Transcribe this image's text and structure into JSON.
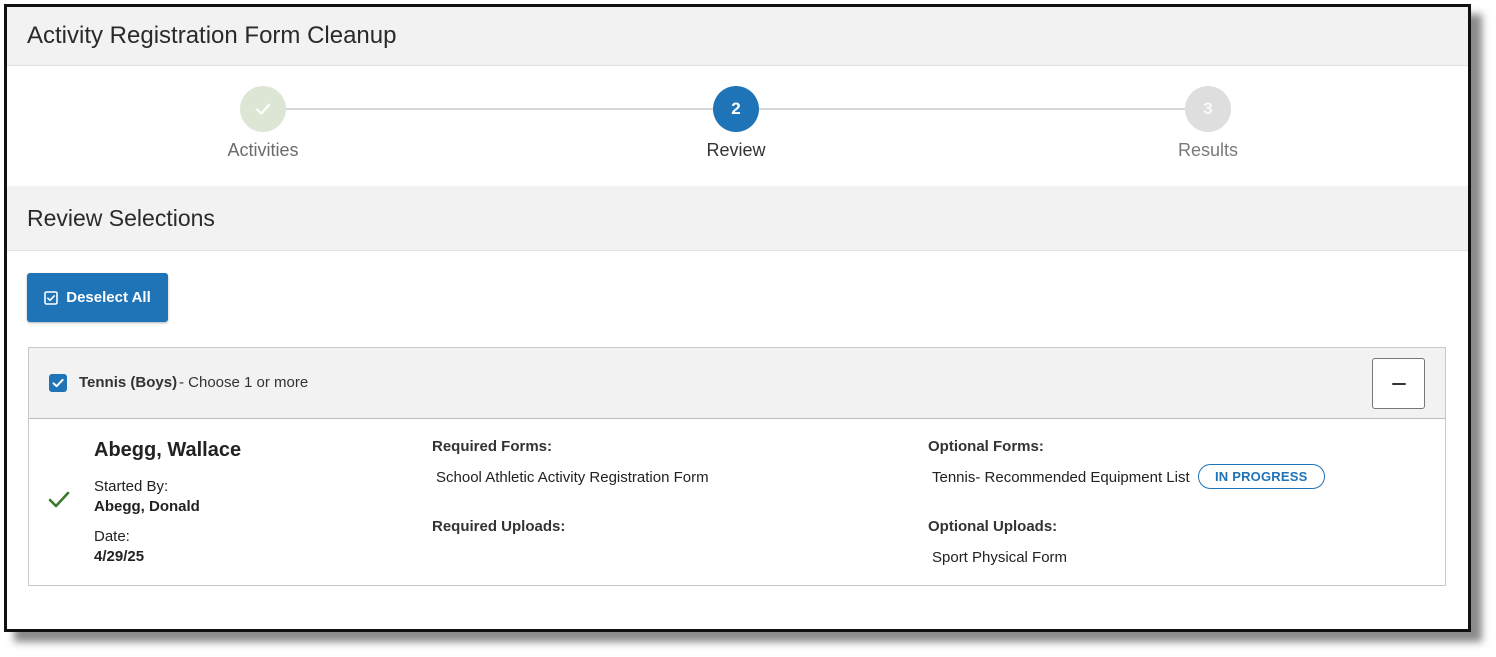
{
  "window": {
    "title": "Activity Registration Form Cleanup"
  },
  "stepper": {
    "steps": [
      {
        "number": "1",
        "label": "Activities",
        "state": "completed"
      },
      {
        "number": "2",
        "label": "Review",
        "state": "active"
      },
      {
        "number": "3",
        "label": "Results",
        "state": "pending"
      }
    ]
  },
  "review": {
    "title": "Review Selections",
    "deselect_all_label": "Deselect All"
  },
  "activity": {
    "name": "Tennis (Boys)",
    "subtitle": "- Choose 1 or more",
    "checked": true
  },
  "student": {
    "name": "Abegg, Wallace",
    "started_by_label": "Started By:",
    "started_by": "Abegg, Donald",
    "date_label": "Date:",
    "date": "4/29/25",
    "required_forms_label": "Required Forms:",
    "required_forms": [
      "School Athletic Activity Registration Form"
    ],
    "required_uploads_label": "Required Uploads:",
    "optional_forms_label": "Optional Forms:",
    "optional_forms": [
      {
        "name": "Tennis- Recommended Equipment List",
        "status": "IN PROGRESS"
      }
    ],
    "optional_uploads_label": "Optional Uploads:",
    "optional_uploads": [
      "Sport Physical Form"
    ]
  },
  "colors": {
    "primary": "#1f73b7",
    "completed_step": "#dde6d5",
    "pending_step": "#dedede",
    "success_check": "#3a7a2a"
  }
}
